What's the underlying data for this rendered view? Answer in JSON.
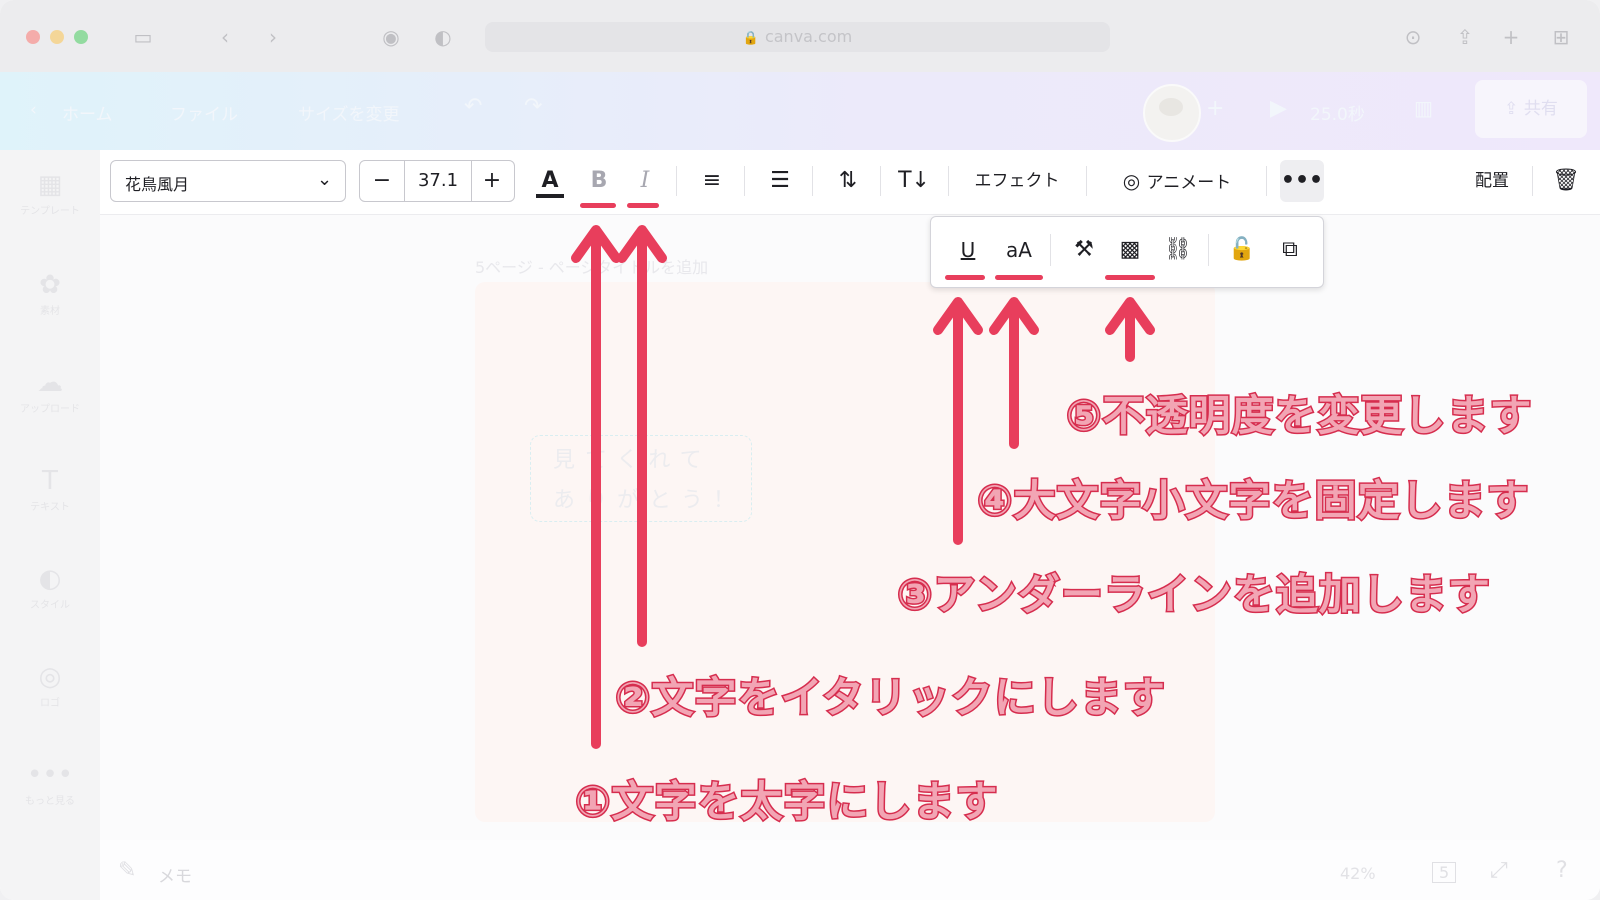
{
  "browser": {
    "url": "canva.com"
  },
  "header": {
    "home": "ホーム",
    "file": "ファイル",
    "resize": "サイズを変更",
    "duration": "25.0秒",
    "share": "共有"
  },
  "sidebar": {
    "items": [
      {
        "label": "テンプレート",
        "icon": "▦"
      },
      {
        "label": "素材",
        "icon": "✿"
      },
      {
        "label": "アップロード",
        "icon": "☁"
      },
      {
        "label": "テキスト",
        "icon": "T"
      },
      {
        "label": "スタイル",
        "icon": "◐"
      },
      {
        "label": "ロゴ",
        "icon": "◎"
      },
      {
        "label": "もっと見る",
        "icon": "•••"
      }
    ]
  },
  "toolbar": {
    "font_name": "花鳥風月",
    "font_size": "37.1",
    "decrease": "−",
    "increase": "+",
    "effects": "エフェクト",
    "animate": "アニメート",
    "position": "配置",
    "more": "•••"
  },
  "canvas": {
    "page_title": "5ページ - ページタイトルを追加",
    "text_line1": "見てくれて",
    "text_line2": "ありがとう！",
    "memo": "メモ",
    "zoom": "42%",
    "page_count": "5"
  },
  "annotations": [
    {
      "id": 1,
      "text": "①文字を太字にします"
    },
    {
      "id": 2,
      "text": "②文字をイタリックにします"
    },
    {
      "id": 3,
      "text": "③アンダーラインを追加します"
    },
    {
      "id": 4,
      "text": "④大文字小文字を固定します"
    },
    {
      "id": 5,
      "text": "⑤不透明度を変更します"
    }
  ],
  "colors": {
    "annotation_red": "#e83e5c",
    "annotation_fill": "#f2a5b4"
  }
}
